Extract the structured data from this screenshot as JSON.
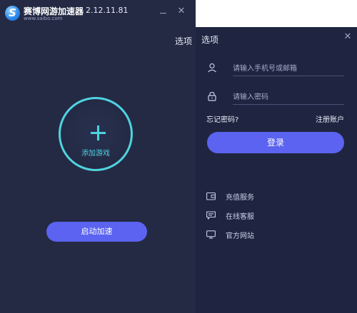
{
  "app": {
    "name": "赛博网游加速器",
    "version": "2.12.11.81",
    "url": "www.saibo.com",
    "logo_letter": "S",
    "options_label": "选项"
  },
  "main": {
    "add_game_label": "添加游戏",
    "start_button": "启动加速"
  },
  "login_panel": {
    "title": "选项",
    "phone_placeholder": "请输入手机号或邮箱",
    "password_placeholder": "请输入密码",
    "forgot_password": "忘记密码?",
    "register": "注册账户",
    "login_button": "登录",
    "links": [
      {
        "label": "充值服务",
        "icon": "wallet-icon"
      },
      {
        "label": "在线客服",
        "icon": "chat-icon"
      },
      {
        "label": "官方网站",
        "icon": "monitor-icon"
      }
    ]
  },
  "colors": {
    "main_bg": "#242a44",
    "panel_bg": "#1f2540",
    "accent_cyan": "#4fd3e0",
    "button_blue": "#5b63f0"
  }
}
